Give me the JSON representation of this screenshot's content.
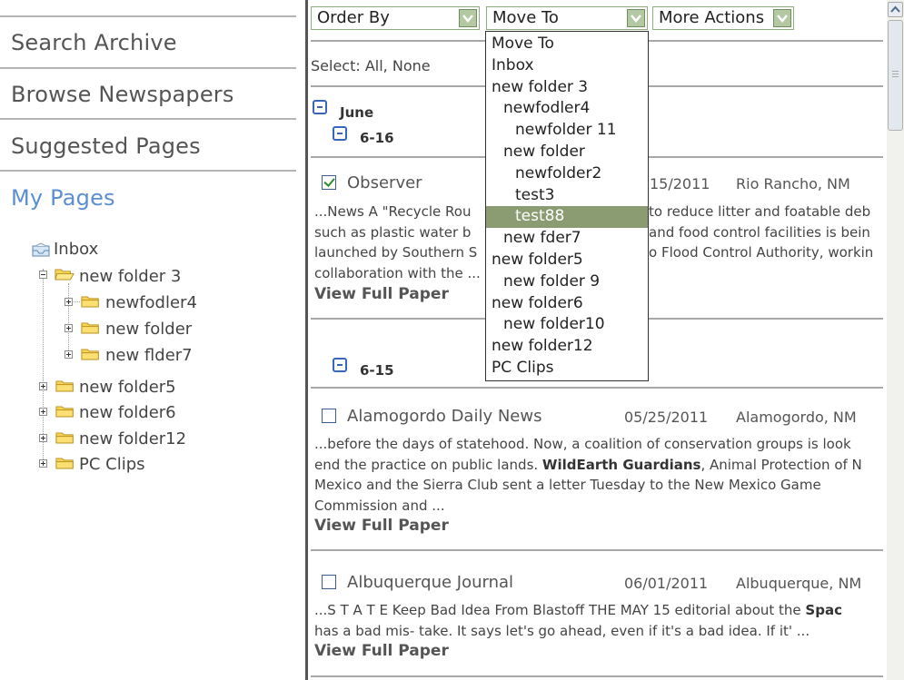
{
  "nav": {
    "search": "Search Archive",
    "browse": "Browse Newspapers",
    "suggested": "Suggested Pages",
    "mypages": "My Pages"
  },
  "tree": {
    "inbox": "Inbox",
    "folder3": "new folder 3",
    "newfodler4": "newfodler4",
    "newfolder": "new folder",
    "newflder7": "new flder7",
    "folder5": "new folder5",
    "folder6": "new folder6",
    "folder12": "new folder12",
    "pcclips": "PC Clips"
  },
  "toolbar": {
    "order_by": "Order By",
    "move_to": "Move To",
    "more_actions": "More Actions"
  },
  "select_text": "Select: All, None",
  "groups": {
    "month": "June",
    "day1": "6-16",
    "day2": "6-15"
  },
  "results": [
    {
      "title": "Observer",
      "date": "15/2011",
      "place": "Rio Rancho, NM",
      "checked": true,
      "lines": [
        "...News A \"Recycle Rou",
        "such as plastic water b",
        "launched by Southern S",
        "collaboration with the ..."
      ],
      "lines_right": [
        "to reduce litter and foatable deb",
        "and food control facilities is bein",
        "o Flood Control Authority, workin",
        ""
      ],
      "link": "View Full Paper"
    },
    {
      "title": "Alamogordo Daily News",
      "date": "05/25/2011",
      "place": "Alamogordo, NM",
      "checked": false,
      "line1": "...before the days of statehood. Now, a coalition of conservation groups is look",
      "line2a": "end the practice on public lands. ",
      "line2b": "WildEarth Guardians",
      "line2c": ", Animal Protection of N",
      "line3": "Mexico and the Sierra Club sent a letter Tuesday to the New Mexico Game",
      "line4": "Commission and ...",
      "link": "View Full Paper"
    },
    {
      "title": "Albuquerque Journal",
      "date": "06/01/2011",
      "place": "Albuquerque, NM",
      "checked": false,
      "line1a": "...S T A T E Keep Bad Idea From Blastoff THE MAY 15 editorial about the ",
      "line1b": "Spac",
      "line2": "has a bad mis- take. It says let's go ahead, even if it's a bad idea. If it' ...",
      "link": "View Full Paper"
    }
  ],
  "dropdown": {
    "selected": "test88",
    "options": [
      {
        "label": "Move To",
        "level": 0
      },
      {
        "label": "Inbox",
        "level": 0
      },
      {
        "label": "new folder 3",
        "level": 0
      },
      {
        "label": "newfodler4",
        "level": 1
      },
      {
        "label": "newfolder 11",
        "level": 2
      },
      {
        "label": "new folder",
        "level": 1
      },
      {
        "label": "newfolder2",
        "level": 2
      },
      {
        "label": "test3",
        "level": 2
      },
      {
        "label": "test88",
        "level": 2
      },
      {
        "label": "new fder7",
        "level": 1
      },
      {
        "label": "new folder5",
        "level": 0
      },
      {
        "label": "new folder 9",
        "level": 1
      },
      {
        "label": "new folder6",
        "level": 0
      },
      {
        "label": "new folder10",
        "level": 1
      },
      {
        "label": "new folder12",
        "level": 0
      },
      {
        "label": "PC Clips",
        "level": 0
      }
    ]
  },
  "colors": {
    "nav_active": "#5b8fd1",
    "select_border": "#8fae7d",
    "highlight": "#8b9c73",
    "collapse_blue": "#3667b8"
  }
}
